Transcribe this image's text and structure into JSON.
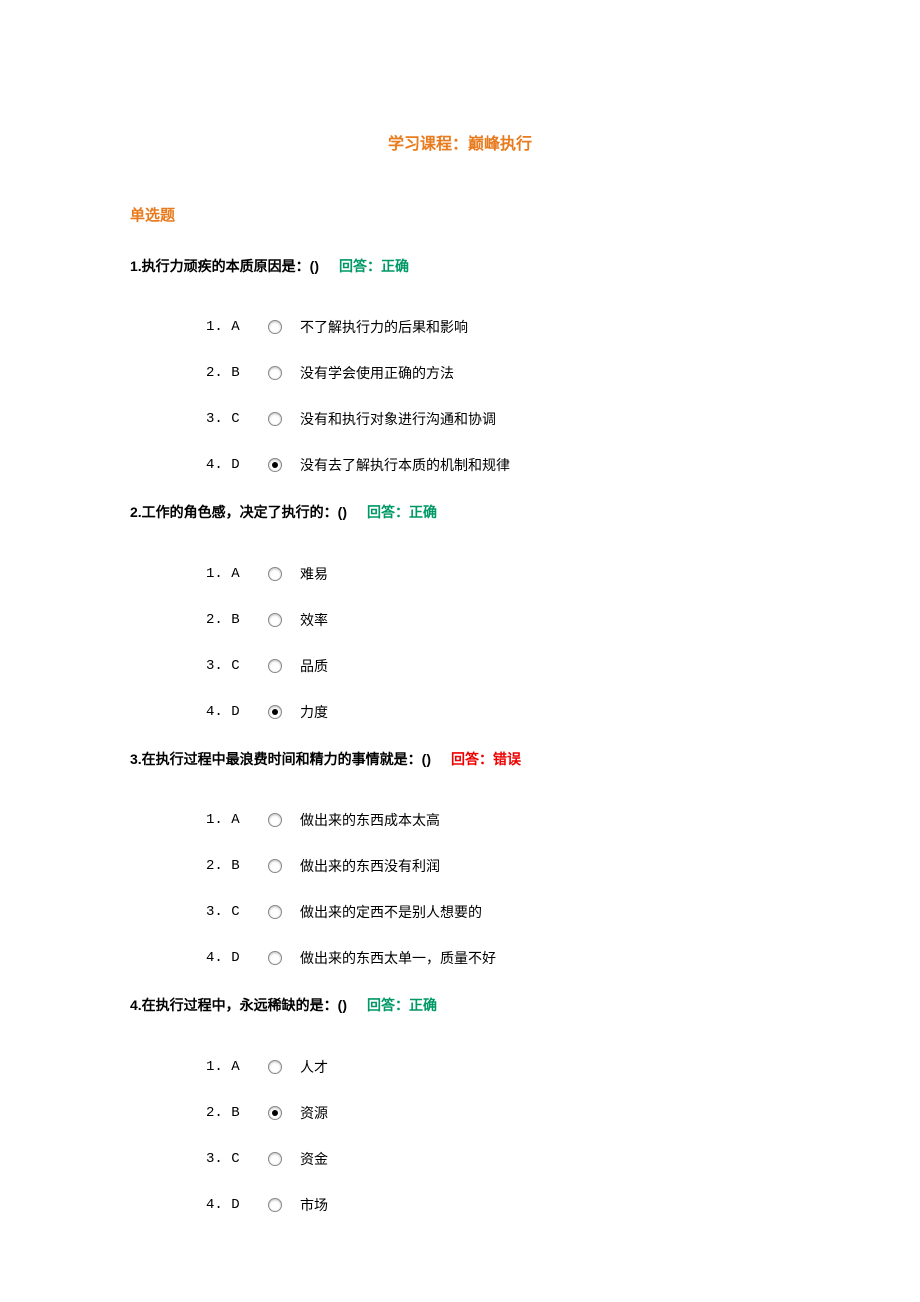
{
  "course_title": "学习课程：巅峰执行",
  "section_title": "单选题",
  "answer_prefix": "回答：",
  "questions": [
    {
      "num": "1",
      "stem": "执行力顽疾的本质原因是：()",
      "result": "正确",
      "result_kind": "correct",
      "options": [
        {
          "idx": "1.",
          "letter": "A",
          "text": "不了解执行力的后果和影响",
          "checked": false
        },
        {
          "idx": "2.",
          "letter": "B",
          "text": "没有学会使用正确的方法",
          "checked": false
        },
        {
          "idx": "3.",
          "letter": "C",
          "text": "没有和执行对象进行沟通和协调",
          "checked": false
        },
        {
          "idx": "4.",
          "letter": "D",
          "text": "没有去了解执行本质的机制和规律",
          "checked": true
        }
      ]
    },
    {
      "num": "2",
      "stem": "工作的角色感，决定了执行的：()",
      "result": "正确",
      "result_kind": "correct",
      "options": [
        {
          "idx": "1.",
          "letter": "A",
          "text": "难易",
          "checked": false
        },
        {
          "idx": "2.",
          "letter": "B",
          "text": "效率",
          "checked": false
        },
        {
          "idx": "3.",
          "letter": "C",
          "text": "品质",
          "checked": false
        },
        {
          "idx": "4.",
          "letter": "D",
          "text": "力度",
          "checked": true
        }
      ]
    },
    {
      "num": "3",
      "stem": "在执行过程中最浪费时间和精力的事情就是：()",
      "result": "错误",
      "result_kind": "wrong",
      "options": [
        {
          "idx": "1.",
          "letter": "A",
          "text": "做出来的东西成本太高",
          "checked": false
        },
        {
          "idx": "2.",
          "letter": "B",
          "text": "做出来的东西没有利润",
          "checked": false
        },
        {
          "idx": "3.",
          "letter": "C",
          "text": "做出来的定西不是别人想要的",
          "checked": false
        },
        {
          "idx": "4.",
          "letter": "D",
          "text": "做出来的东西太单一，质量不好",
          "checked": false
        }
      ]
    },
    {
      "num": "4",
      "stem": "在执行过程中，永远稀缺的是：()",
      "result": "正确",
      "result_kind": "correct",
      "options": [
        {
          "idx": "1.",
          "letter": "A",
          "text": "人才",
          "checked": false
        },
        {
          "idx": "2.",
          "letter": "B",
          "text": "资源",
          "checked": true
        },
        {
          "idx": "3.",
          "letter": "C",
          "text": "资金",
          "checked": false
        },
        {
          "idx": "4.",
          "letter": "D",
          "text": "市场",
          "checked": false
        }
      ]
    }
  ]
}
